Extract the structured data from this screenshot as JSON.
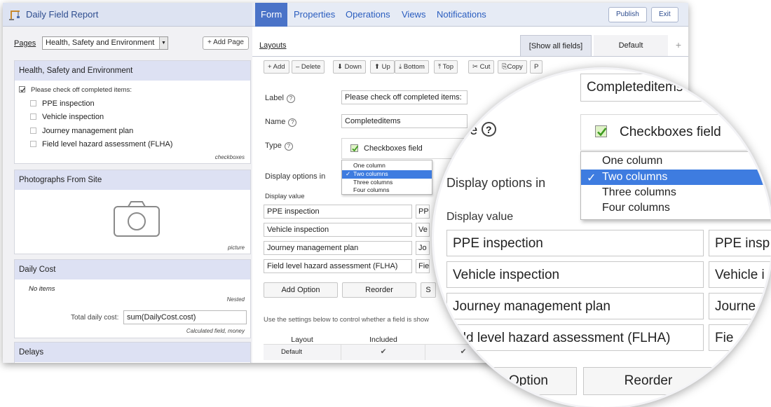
{
  "app": {
    "title": "Daily Field Report",
    "nav_tabs": [
      "Form",
      "Properties",
      "Operations",
      "Views",
      "Notifications"
    ],
    "publish_label": "Publish",
    "exit_label": "Exit"
  },
  "pages": {
    "label": "Pages",
    "selected": "Health, Safety and Environment",
    "add_page_label": "+ Add Page"
  },
  "sections": {
    "hse": {
      "title": "Health, Safety and Environment",
      "prompt": "Please check off completed items:",
      "items": [
        "PPE inspection",
        "Vehicle inspection",
        "Journey management plan",
        "Field level hazard assessment (FLHA)"
      ],
      "type_note": "checkboxes"
    },
    "photos": {
      "title": "Photographs From Site",
      "type_note": "picture"
    },
    "cost": {
      "title": "Daily Cost",
      "no_items": "No items",
      "nested_note": "Nested",
      "total_label": "Total daily cost:",
      "total_value": "sum(DailyCost.cost)",
      "calc_note": "Calculated field, money"
    },
    "delays": {
      "title": "Delays"
    }
  },
  "layouts": {
    "link": "Layouts",
    "show_all_tab": "[Show all fields]",
    "default_tab": "Default",
    "add_tab": "+"
  },
  "toolbar": {
    "add": "+ Add",
    "delete": "– Delete",
    "down": "Down",
    "up": "Up",
    "bottom": "Bottom",
    "top": "Top",
    "cut": "Cut",
    "copy": "Copy",
    "paste": "P"
  },
  "field": {
    "label_caption": "Label",
    "label_value": "Please check off completed items:",
    "name_caption": "Name",
    "name_value": "Completeditems",
    "type_caption": "Type",
    "type_value": "Checkboxes field",
    "display_options_caption": "Display options in",
    "display_options": [
      "One column",
      "Two columns",
      "Three columns",
      "Four columns"
    ],
    "display_options_selected": "Two columns",
    "display_value_caption": "Display value",
    "values": [
      "PPE inspection",
      "Vehicle inspection",
      "Journey management plan",
      "Field level hazard assessment (FLHA)"
    ],
    "values_col2": [
      "PP",
      "Ve",
      "Jo",
      "Fie"
    ]
  },
  "actions": {
    "add_option": "Add Option",
    "reorder": "Reorder",
    "third": "S"
  },
  "settings_note": "Use the settings below to control whether a field is show",
  "layout_table": {
    "headers": [
      "Layout",
      "Included"
    ],
    "rows": [
      {
        "layout": "Default",
        "included": "✔",
        "col3": "✔"
      }
    ]
  },
  "magnifier": {
    "name_value": "Completeditems",
    "type_caption": "ype",
    "type_value": "Checkboxes field",
    "display_options_caption": "Display options in",
    "display_value_caption": "Display value",
    "values": [
      "PPE inspection",
      "Vehicle inspection",
      "Journey management plan",
      "ield level hazard assessment (FLHA)"
    ],
    "values_col2": [
      "PPE insp",
      "Vehicle i",
      "Journe",
      "Fie"
    ],
    "add_option_partial": "Option",
    "reorder": "Reorder"
  },
  "colors": {
    "accent": "#4a73c8",
    "selection": "#3e7ce0",
    "section_header": "#dde1f3"
  }
}
